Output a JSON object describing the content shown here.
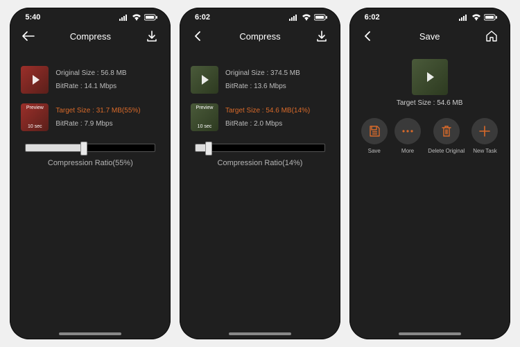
{
  "screens": [
    {
      "time": "5:40",
      "title": "Compress",
      "left_icon": "back",
      "right_icon": "download",
      "original": {
        "size_label": "Original Size : 56.8 MB",
        "bitrate_label": "BitRate : 14.1 Mbps"
      },
      "target": {
        "size_label": "Target Size : 31.7 MB(55%)",
        "bitrate_label": "BitRate : 7.9 Mbps",
        "preview": "Preview",
        "duration": "10 sec"
      },
      "slider": {
        "percent": 55,
        "label": "Compression Ratio(55%)"
      }
    },
    {
      "time": "6:02",
      "title": "Compress",
      "left_icon": "back",
      "right_icon": "download",
      "original": {
        "size_label": "Original Size : 374.5 MB",
        "bitrate_label": "BitRate : 13.6 Mbps"
      },
      "target": {
        "size_label": "Target Size : 54.6 MB(14%)",
        "bitrate_label": "BitRate : 2.0 Mbps",
        "preview": "Preview",
        "duration": "10 sec"
      },
      "slider": {
        "percent": 14,
        "label": "Compression Ratio(14%)"
      }
    },
    {
      "time": "6:02",
      "title": "Save",
      "left_icon": "back",
      "right_icon": "home",
      "target_line": "Target Size : 54.6 MB",
      "actions": [
        {
          "key": "save",
          "label": "Save"
        },
        {
          "key": "more",
          "label": "More"
        },
        {
          "key": "delete",
          "label": "Delete Original"
        },
        {
          "key": "new",
          "label": "New Task"
        }
      ]
    }
  ]
}
